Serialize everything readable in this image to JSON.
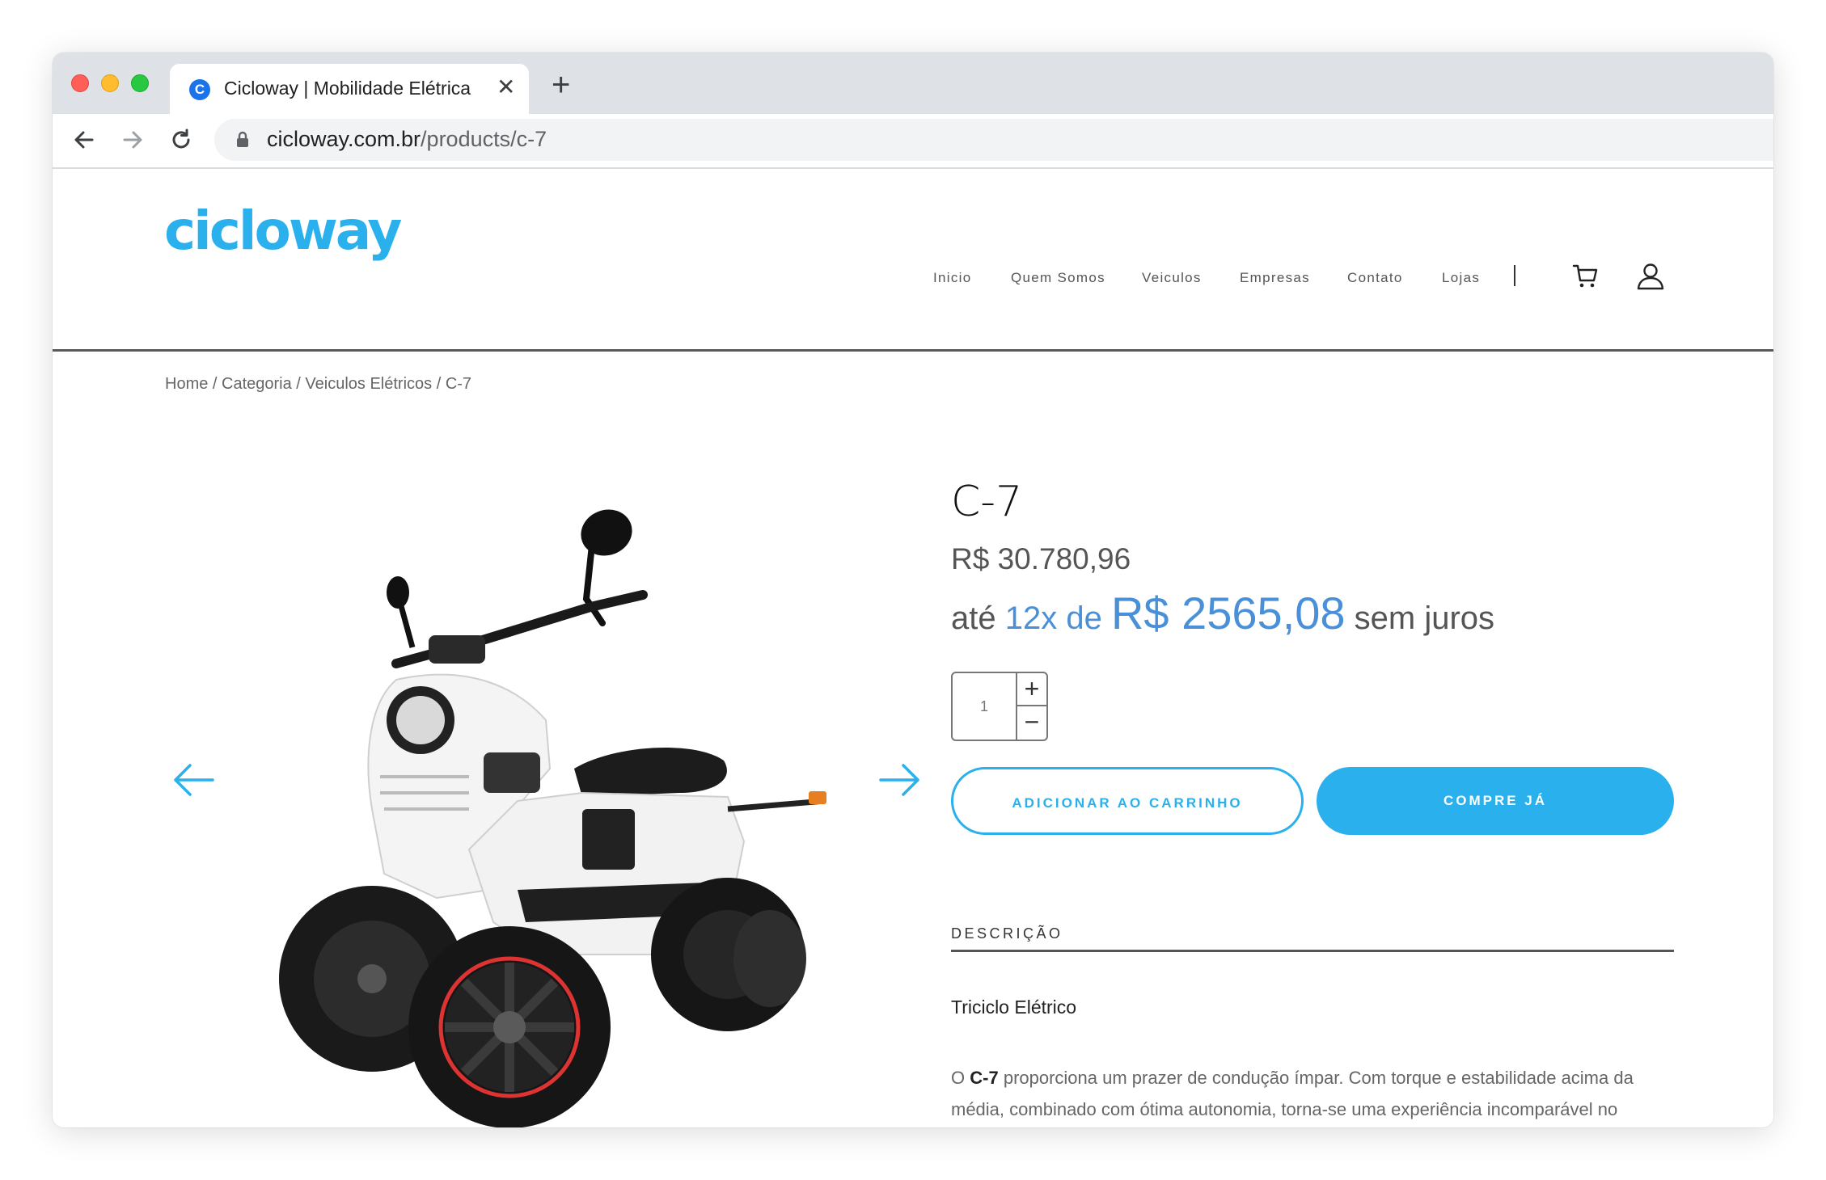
{
  "browser": {
    "tab_title": "Cicloway | Mobilidade Elétrica",
    "favicon_letter": "C",
    "url_domain": "cicloway.com.br",
    "url_path": "/products/c-7",
    "new_tab_label": "+",
    "close_label": "✕"
  },
  "site": {
    "logo_text": "cicloway",
    "brand_color": "#2ab0ec",
    "nav": [
      "Inicio",
      "Quem Somos",
      "Veiculos",
      "Empresas",
      "Contato",
      "Lojas"
    ],
    "breadcrumb": "Home / Categoria / Veiculos Elétricos / C-7"
  },
  "product": {
    "title": "C-7",
    "price": "R$ 30.780,96",
    "installment_prefix": "até",
    "installment_count": "12x de",
    "installment_value": "R$ 2565,08",
    "installment_suffix": "sem juros",
    "quantity": "1",
    "qty_plus": "+",
    "qty_minus": "−",
    "add_to_cart": "ADICIONAR AO CARRINHO",
    "buy_now": "COMPRE JÁ",
    "desc_tab": "DESCRIÇÃO",
    "desc_subtitle": "Triciclo Elétrico",
    "desc_model": "C-7",
    "desc_prefix": "O",
    "desc_text": "proporciona um prazer de condução ímpar. Com torque e estabilidade acima da média, combinado com ótima autonomia, torna-se uma experiência incomparável no segmento."
  }
}
